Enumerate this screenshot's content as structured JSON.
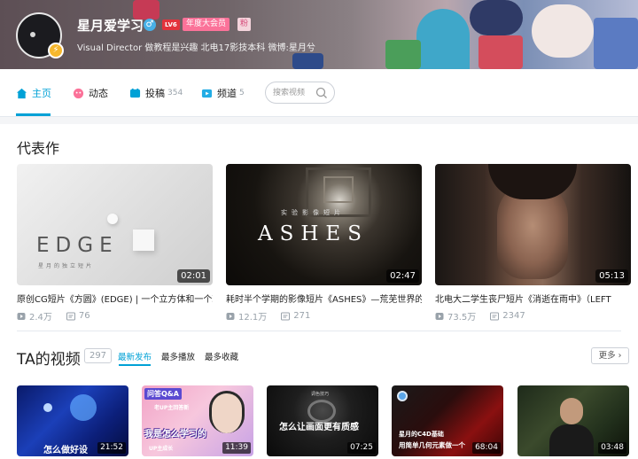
{
  "profile": {
    "username": "星月爱学习",
    "level": "LV6",
    "vip": "年度大会员",
    "fan_badge": "粉",
    "signature": "Visual Director 做教程是兴趣 北电17影技本科 微博:星月兮"
  },
  "nav": {
    "home": "主页",
    "dynamic": "动态",
    "posts": "投稿",
    "posts_count": "354",
    "channels": "频道",
    "channels_count": "5",
    "search_placeholder": "搜索视频"
  },
  "masterpiece": {
    "title": "代表作",
    "cards": [
      {
        "title": "原创CG短片《方圆》(EDGE) | 一个立方体和一个球",
        "duration": "02:01",
        "views": "2.4万",
        "danmaku": "76",
        "cover_text": "EDGE",
        "cover_sub": "星月的独立短片"
      },
      {
        "title": "耗时半个学期的影像短片《ASHES》—荒芜世界的",
        "duration": "02:47",
        "views": "12.1万",
        "danmaku": "271",
        "cover_text": "ASHES",
        "cover_sub": "实验影像短片"
      },
      {
        "title": "北电大二学生丧尸短片《消逝在雨中》（LEFT",
        "duration": "05:13",
        "views": "73.5万",
        "danmaku": "2347"
      }
    ]
  },
  "videos": {
    "title": "TA的视频",
    "count": "297",
    "tabs": [
      "最新发布",
      "最多播放",
      "最多收藏"
    ],
    "more": "更多",
    "items": [
      {
        "duration": "21:52",
        "overlay": "怎么做好设"
      },
      {
        "duration": "11:39",
        "overlay": "我是怎么学习的",
        "overlay2": "问答Q&A",
        "overlay3": "老UP主回答新",
        "overlay4": "UP主成长"
      },
      {
        "duration": "07:25",
        "overlay": "怎么让画面更有质感",
        "overlay2": "调色技巧"
      },
      {
        "duration": "68:04",
        "overlay": "星月的C4D基础",
        "overlay2": "用简单几何元素做一个"
      },
      {
        "duration": "03:48"
      }
    ]
  }
}
